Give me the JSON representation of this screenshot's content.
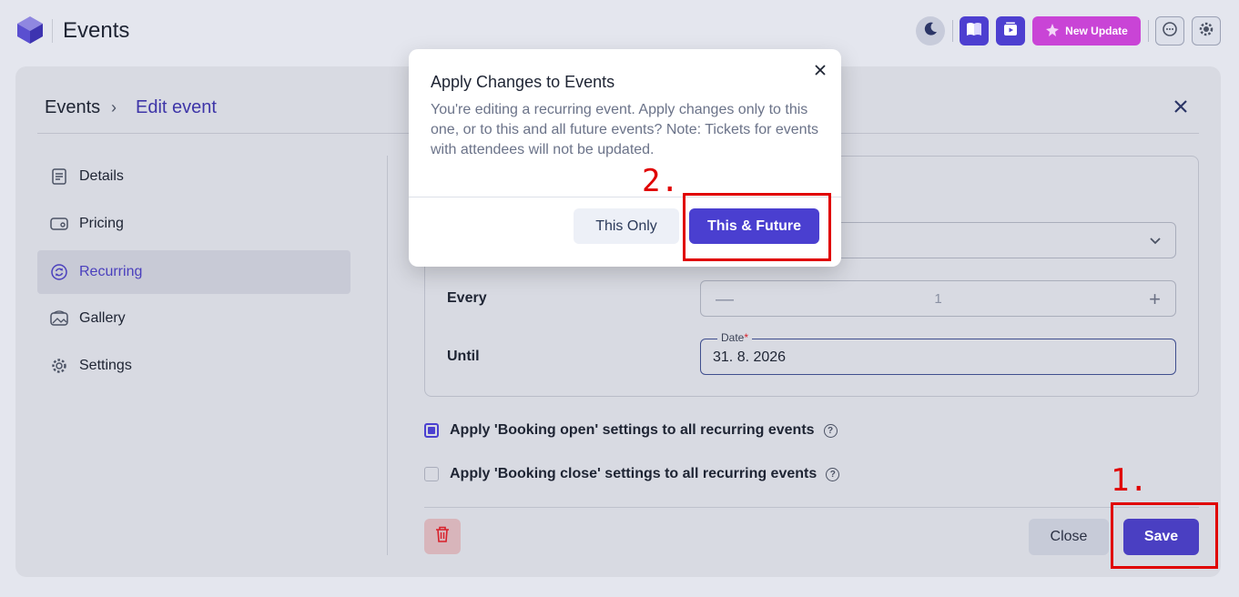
{
  "app": {
    "title": "Events"
  },
  "topbar": {
    "new_update_label": "New Update"
  },
  "breadcrumb": {
    "root": "Events",
    "current": "Edit event"
  },
  "sidebar": {
    "items": [
      {
        "label": "Details",
        "icon": "document-icon"
      },
      {
        "label": "Pricing",
        "icon": "wallet-icon"
      },
      {
        "label": "Recurring",
        "icon": "repeat-icon",
        "active": true
      },
      {
        "label": "Gallery",
        "icon": "gallery-icon"
      },
      {
        "label": "Settings",
        "icon": "gear-icon"
      }
    ]
  },
  "recurring": {
    "every_label": "Every",
    "every_value": "1",
    "until_label": "Until",
    "date_legend": "Date",
    "date_required_mark": "*",
    "date_value": "31. 8. 2026"
  },
  "options": {
    "booking_open_label": "Apply 'Booking open' settings to all recurring events",
    "booking_open_checked": true,
    "booking_close_label": "Apply 'Booking close' settings to all recurring events",
    "booking_close_checked": false
  },
  "footer": {
    "close_label": "Close",
    "save_label": "Save"
  },
  "modal": {
    "title": "Apply Changes to Events",
    "body": "You're editing a recurring event. Apply changes only to this one, or to this and all future events? Note: Tickets for events with attendees will not be updated.",
    "this_only_label": "This Only",
    "this_future_label": "This & Future"
  },
  "annotations": {
    "step1": "1.",
    "step2": "2."
  },
  "colors": {
    "accent": "#4a3fd0",
    "annotation": "#e00000",
    "new_update": "#c944d6"
  }
}
